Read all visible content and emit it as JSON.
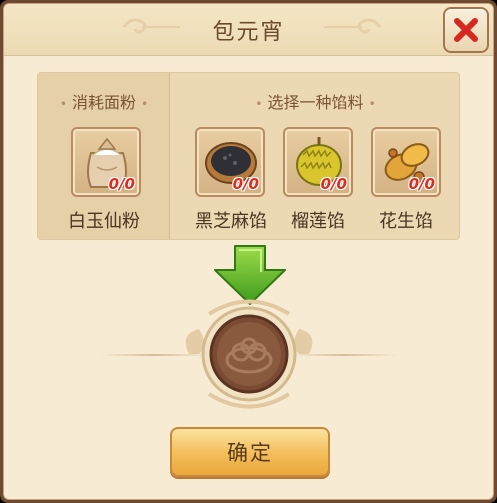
{
  "dialog": {
    "title": "包元宵",
    "close_icon": "close-x-icon"
  },
  "flour_section": {
    "label": "消耗面粉",
    "items": [
      {
        "name": "白玉仙粉",
        "count": "0/0",
        "icon": "flour-sack-icon"
      }
    ]
  },
  "filling_section": {
    "label": "选择一种馅料",
    "items": [
      {
        "name": "黑芝麻馅",
        "count": "0/0",
        "icon": "black-sesame-bowl-icon"
      },
      {
        "name": "榴莲馅",
        "count": "0/0",
        "icon": "durian-icon"
      },
      {
        "name": "花生馅",
        "count": "0/0",
        "icon": "peanut-icon"
      }
    ]
  },
  "result": {
    "icon": "tangyuan-bowl-icon",
    "arrow_icon": "green-down-arrow-icon"
  },
  "confirm": {
    "label": "确定"
  },
  "colors": {
    "accent": "#f4c05d",
    "count_red": "#e22a1e",
    "arrow_green": "#5fb82a",
    "bowl_brown": "#7a4a32"
  }
}
